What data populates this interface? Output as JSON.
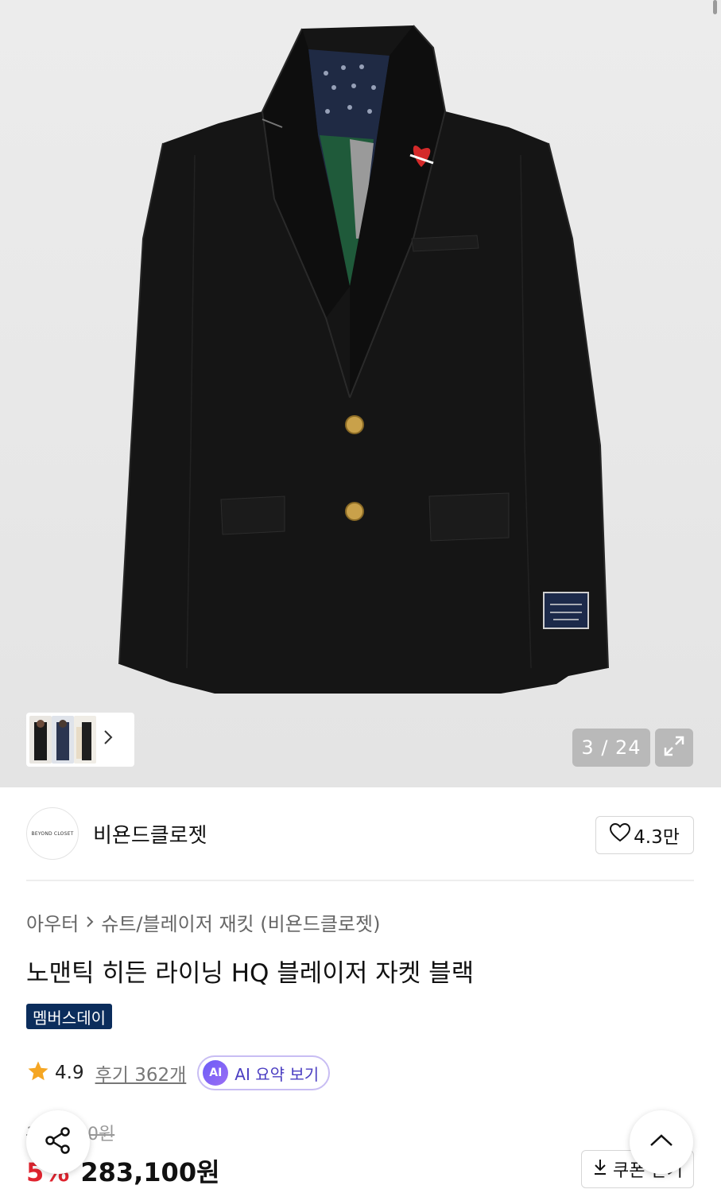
{
  "gallery": {
    "counter": "3 / 24",
    "product_image": "black-blazer-with-bandana-lining",
    "thumbnails": [
      "thumbnail-model-black",
      "thumbnail-model-navy",
      "thumbnail-model-ivory"
    ],
    "thumb_more_icon": "chevron-right-icon",
    "expand_icon": "expand-icon"
  },
  "brand": {
    "logo_text": "BEYOND CLOSET",
    "name": "비욘드클로젯",
    "like_icon": "heart-outline-icon",
    "like_count": "4.3만"
  },
  "breadcrumb": {
    "category": "아우터",
    "separator_icon": "chevron-right-icon",
    "subcategory": "슈트/블레이저 재킷 (비욘드클로젯)"
  },
  "product": {
    "title": "노맨틱 히든 라이닝 HQ 블레이저 자켓 블랙",
    "badge": "멤버스데이",
    "rating": "4.9",
    "reviews": "후기 362개",
    "ai_chip": "AI",
    "ai_summary_label": "AI 요약 보기",
    "original_price": "300,100원",
    "discount": "5%",
    "price": "283,100원"
  },
  "actions": {
    "share_icon": "share-icon",
    "scroll_top_icon": "chevron-up-icon",
    "coupon_icon": "download-icon",
    "coupon_label": "쿠폰 받기"
  },
  "colors": {
    "badge_bg": "#0b2d5c",
    "discount": "#e0242f",
    "star": "#f5a623",
    "ai_accent": "#6b5cf6"
  }
}
